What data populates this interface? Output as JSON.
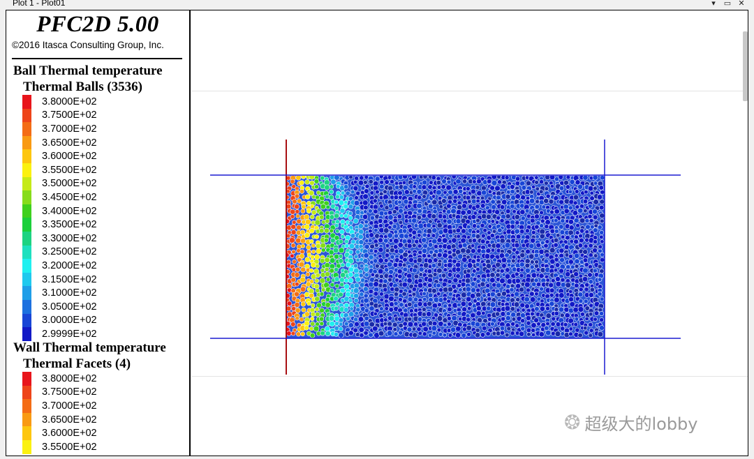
{
  "window": {
    "title": "Plot 1 - Plot01",
    "controls": {
      "menu": "▾",
      "restore": "▭",
      "close": "✕"
    }
  },
  "legend": {
    "app_name": "PFC2D 5.00",
    "copyright": "©2016 Itasca Consulting Group, Inc.",
    "ball_section": {
      "title": "Ball Thermal temperature",
      "subtitle": "Thermal Balls (3536)",
      "entries": [
        {
          "label": "3.8000E+02",
          "color": "#e8151b"
        },
        {
          "label": "3.7500E+02",
          "color": "#ee4419"
        },
        {
          "label": "3.7000E+02",
          "color": "#f46c15"
        },
        {
          "label": "3.6500E+02",
          "color": "#f99a13"
        },
        {
          "label": "3.6000E+02",
          "color": "#fdc60f"
        },
        {
          "label": "3.5500E+02",
          "color": "#fbf110"
        },
        {
          "label": "3.5000E+02",
          "color": "#c5ea17"
        },
        {
          "label": "3.4500E+02",
          "color": "#86dc1b"
        },
        {
          "label": "3.4000E+02",
          "color": "#3fd01d"
        },
        {
          "label": "3.3500E+02",
          "color": "#1bcf3a"
        },
        {
          "label": "3.3000E+02",
          "color": "#1dd381"
        },
        {
          "label": "3.2500E+02",
          "color": "#1ee0bf"
        },
        {
          "label": "3.2000E+02",
          "color": "#1ff0f0"
        },
        {
          "label": "3.1500E+02",
          "color": "#1fc9ee"
        },
        {
          "label": "3.1000E+02",
          "color": "#1f9ee8"
        },
        {
          "label": "3.0500E+02",
          "color": "#1c70df"
        },
        {
          "label": "3.0000E+02",
          "color": "#1845d6"
        },
        {
          "label": "2.9999E+02",
          "color": "#1219c6"
        }
      ]
    },
    "wall_section": {
      "title": "Wall Thermal temperature",
      "subtitle": "Thermal Facets (4)",
      "entries": [
        {
          "label": "3.8000E+02",
          "color": "#e8151b"
        },
        {
          "label": "3.7500E+02",
          "color": "#ee4419"
        },
        {
          "label": "3.7000E+02",
          "color": "#f46c15"
        },
        {
          "label": "3.6500E+02",
          "color": "#f99a13"
        },
        {
          "label": "3.6000E+02",
          "color": "#fdc60f"
        },
        {
          "label": "3.5500E+02",
          "color": "#fbf110"
        }
      ]
    }
  },
  "model": {
    "wall_hot_color": "#a80f12",
    "wall_cold_color": "#1a1ad0",
    "hot_temperature": 380,
    "cold_temperature": 299.99
  },
  "watermark": {
    "text": "超级大的lobby",
    "icon": "wechat-icon"
  }
}
